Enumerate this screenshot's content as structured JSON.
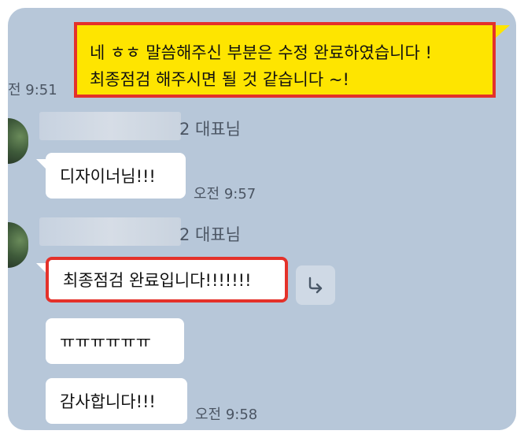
{
  "messages": {
    "outgoing": {
      "line1": "네 ㅎㅎ 말씀해주신 부분은 수정 완료하였습니다 !",
      "line2": "최종점검 해주시면 될 것 같습니다 ~!",
      "time": "전 9:51"
    },
    "sender": {
      "name_suffix": "2 대표님"
    },
    "group1": {
      "bubble1": "디자이너님!!!",
      "time": "오전 9:57"
    },
    "group2": {
      "bubble1": "최종점검 완료입니다!!!!!!!",
      "bubble2": "ㅠㅠㅠㅠㅠㅠ",
      "bubble3": "감사합니다!!!",
      "time": "오전 9:58"
    }
  },
  "colors": {
    "chat_background": "#b7c7d9",
    "outgoing_bubble": "#fee500",
    "highlight_border": "#e4312a"
  },
  "icons": {
    "share": "forward-arrow-icon"
  }
}
